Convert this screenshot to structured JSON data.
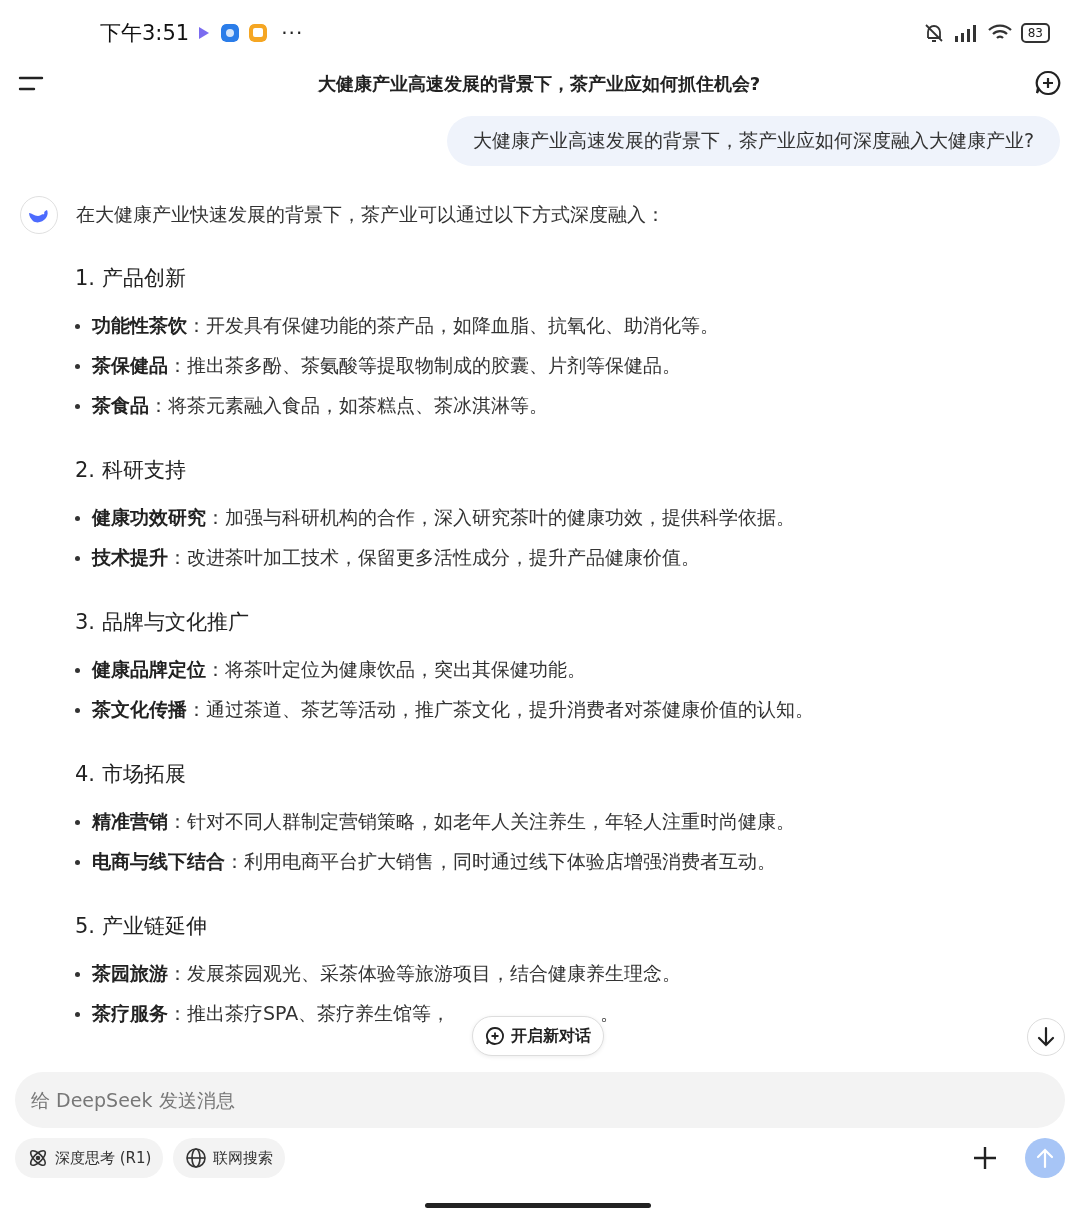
{
  "status_bar": {
    "time": "下午3:51",
    "more": "···",
    "battery": "83"
  },
  "header": {
    "title": "大健康产业高速发展的背景下，茶产业应如何抓住机会?"
  },
  "user_message": "大健康产业高速发展的背景下，茶产业应如何深度融入大健康产业?",
  "answer": {
    "intro": "在大健康产业快速发展的背景下，茶产业可以通过以下方式深度融入：",
    "sections": [
      {
        "heading": "1. 产品创新",
        "items": [
          {
            "label": "功能性茶饮",
            "text": "：开发具有保健功能的茶产品，如降血脂、抗氧化、助消化等。"
          },
          {
            "label": "茶保健品",
            "text": "：推出茶多酚、茶氨酸等提取物制成的胶囊、片剂等保健品。"
          },
          {
            "label": "茶食品",
            "text": "：将茶元素融入食品，如茶糕点、茶冰淇淋等。"
          }
        ]
      },
      {
        "heading": "2. 科研支持",
        "items": [
          {
            "label": "健康功效研究",
            "text": "：加强与科研机构的合作，深入研究茶叶的健康功效，提供科学依据。"
          },
          {
            "label": "技术提升",
            "text": "：改进茶叶加工技术，保留更多活性成分，提升产品健康价值。"
          }
        ]
      },
      {
        "heading": "3. 品牌与文化推广",
        "items": [
          {
            "label": "健康品牌定位",
            "text": "：将茶叶定位为健康饮品，突出其保健功能。"
          },
          {
            "label": "茶文化传播",
            "text": "：通过茶道、茶艺等活动，推广茶文化，提升消费者对茶健康价值的认知。"
          }
        ]
      },
      {
        "heading": "4. 市场拓展",
        "items": [
          {
            "label": "精准营销",
            "text": "：针对不同人群制定营销策略，如老年人关注养生，年轻人注重时尚健康。"
          },
          {
            "label": "电商与线下结合",
            "text": "：利用电商平台扩大销售，同时通过线下体验店增强消费者互动。"
          }
        ]
      },
      {
        "heading": "5. 产业链延伸",
        "items": [
          {
            "label": "茶园旅游",
            "text": "：发展茶园观光、采茶体验等旅游项目，结合健康养生理念。"
          },
          {
            "label": "茶疗服务",
            "text": "：推出茶疗SPA、茶疗养生馆等，",
            "tail": "。"
          }
        ]
      }
    ]
  },
  "new_chat_button": "开启新对话",
  "composer": {
    "placeholder": "给 DeepSeek 发送消息",
    "chips": [
      {
        "label": "深度思考 (R1)",
        "kind": "think",
        "selected": false
      },
      {
        "label": "联网搜索",
        "kind": "web",
        "selected": false
      }
    ]
  }
}
